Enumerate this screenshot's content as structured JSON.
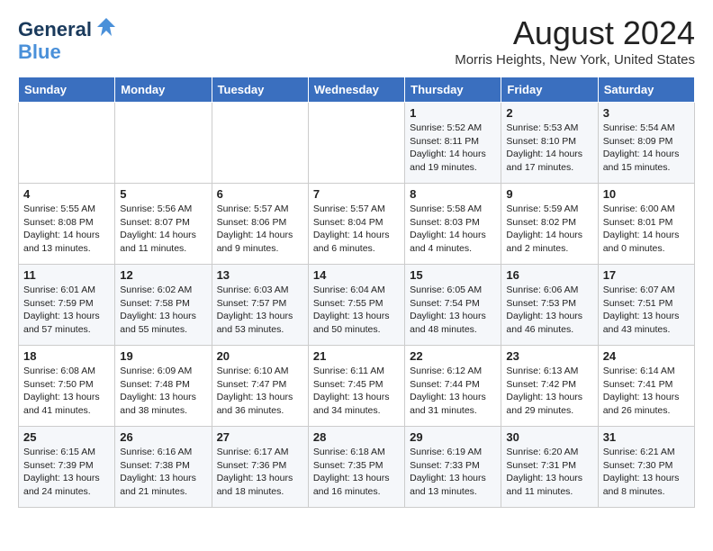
{
  "logo": {
    "general": "General",
    "blue": "Blue",
    "bird_symbol": "🐦"
  },
  "title": "August 2024",
  "location": "Morris Heights, New York, United States",
  "weekdays": [
    "Sunday",
    "Monday",
    "Tuesday",
    "Wednesday",
    "Thursday",
    "Friday",
    "Saturday"
  ],
  "weeks": [
    [
      {
        "day": "",
        "sunrise": "",
        "sunset": "",
        "daylight": ""
      },
      {
        "day": "",
        "sunrise": "",
        "sunset": "",
        "daylight": ""
      },
      {
        "day": "",
        "sunrise": "",
        "sunset": "",
        "daylight": ""
      },
      {
        "day": "",
        "sunrise": "",
        "sunset": "",
        "daylight": ""
      },
      {
        "day": "1",
        "sunrise": "Sunrise: 5:52 AM",
        "sunset": "Sunset: 8:11 PM",
        "daylight": "Daylight: 14 hours and 19 minutes."
      },
      {
        "day": "2",
        "sunrise": "Sunrise: 5:53 AM",
        "sunset": "Sunset: 8:10 PM",
        "daylight": "Daylight: 14 hours and 17 minutes."
      },
      {
        "day": "3",
        "sunrise": "Sunrise: 5:54 AM",
        "sunset": "Sunset: 8:09 PM",
        "daylight": "Daylight: 14 hours and 15 minutes."
      }
    ],
    [
      {
        "day": "4",
        "sunrise": "Sunrise: 5:55 AM",
        "sunset": "Sunset: 8:08 PM",
        "daylight": "Daylight: 14 hours and 13 minutes."
      },
      {
        "day": "5",
        "sunrise": "Sunrise: 5:56 AM",
        "sunset": "Sunset: 8:07 PM",
        "daylight": "Daylight: 14 hours and 11 minutes."
      },
      {
        "day": "6",
        "sunrise": "Sunrise: 5:57 AM",
        "sunset": "Sunset: 8:06 PM",
        "daylight": "Daylight: 14 hours and 9 minutes."
      },
      {
        "day": "7",
        "sunrise": "Sunrise: 5:57 AM",
        "sunset": "Sunset: 8:04 PM",
        "daylight": "Daylight: 14 hours and 6 minutes."
      },
      {
        "day": "8",
        "sunrise": "Sunrise: 5:58 AM",
        "sunset": "Sunset: 8:03 PM",
        "daylight": "Daylight: 14 hours and 4 minutes."
      },
      {
        "day": "9",
        "sunrise": "Sunrise: 5:59 AM",
        "sunset": "Sunset: 8:02 PM",
        "daylight": "Daylight: 14 hours and 2 minutes."
      },
      {
        "day": "10",
        "sunrise": "Sunrise: 6:00 AM",
        "sunset": "Sunset: 8:01 PM",
        "daylight": "Daylight: 14 hours and 0 minutes."
      }
    ],
    [
      {
        "day": "11",
        "sunrise": "Sunrise: 6:01 AM",
        "sunset": "Sunset: 7:59 PM",
        "daylight": "Daylight: 13 hours and 57 minutes."
      },
      {
        "day": "12",
        "sunrise": "Sunrise: 6:02 AM",
        "sunset": "Sunset: 7:58 PM",
        "daylight": "Daylight: 13 hours and 55 minutes."
      },
      {
        "day": "13",
        "sunrise": "Sunrise: 6:03 AM",
        "sunset": "Sunset: 7:57 PM",
        "daylight": "Daylight: 13 hours and 53 minutes."
      },
      {
        "day": "14",
        "sunrise": "Sunrise: 6:04 AM",
        "sunset": "Sunset: 7:55 PM",
        "daylight": "Daylight: 13 hours and 50 minutes."
      },
      {
        "day": "15",
        "sunrise": "Sunrise: 6:05 AM",
        "sunset": "Sunset: 7:54 PM",
        "daylight": "Daylight: 13 hours and 48 minutes."
      },
      {
        "day": "16",
        "sunrise": "Sunrise: 6:06 AM",
        "sunset": "Sunset: 7:53 PM",
        "daylight": "Daylight: 13 hours and 46 minutes."
      },
      {
        "day": "17",
        "sunrise": "Sunrise: 6:07 AM",
        "sunset": "Sunset: 7:51 PM",
        "daylight": "Daylight: 13 hours and 43 minutes."
      }
    ],
    [
      {
        "day": "18",
        "sunrise": "Sunrise: 6:08 AM",
        "sunset": "Sunset: 7:50 PM",
        "daylight": "Daylight: 13 hours and 41 minutes."
      },
      {
        "day": "19",
        "sunrise": "Sunrise: 6:09 AM",
        "sunset": "Sunset: 7:48 PM",
        "daylight": "Daylight: 13 hours and 38 minutes."
      },
      {
        "day": "20",
        "sunrise": "Sunrise: 6:10 AM",
        "sunset": "Sunset: 7:47 PM",
        "daylight": "Daylight: 13 hours and 36 minutes."
      },
      {
        "day": "21",
        "sunrise": "Sunrise: 6:11 AM",
        "sunset": "Sunset: 7:45 PM",
        "daylight": "Daylight: 13 hours and 34 minutes."
      },
      {
        "day": "22",
        "sunrise": "Sunrise: 6:12 AM",
        "sunset": "Sunset: 7:44 PM",
        "daylight": "Daylight: 13 hours and 31 minutes."
      },
      {
        "day": "23",
        "sunrise": "Sunrise: 6:13 AM",
        "sunset": "Sunset: 7:42 PM",
        "daylight": "Daylight: 13 hours and 29 minutes."
      },
      {
        "day": "24",
        "sunrise": "Sunrise: 6:14 AM",
        "sunset": "Sunset: 7:41 PM",
        "daylight": "Daylight: 13 hours and 26 minutes."
      }
    ],
    [
      {
        "day": "25",
        "sunrise": "Sunrise: 6:15 AM",
        "sunset": "Sunset: 7:39 PM",
        "daylight": "Daylight: 13 hours and 24 minutes."
      },
      {
        "day": "26",
        "sunrise": "Sunrise: 6:16 AM",
        "sunset": "Sunset: 7:38 PM",
        "daylight": "Daylight: 13 hours and 21 minutes."
      },
      {
        "day": "27",
        "sunrise": "Sunrise: 6:17 AM",
        "sunset": "Sunset: 7:36 PM",
        "daylight": "Daylight: 13 hours and 18 minutes."
      },
      {
        "day": "28",
        "sunrise": "Sunrise: 6:18 AM",
        "sunset": "Sunset: 7:35 PM",
        "daylight": "Daylight: 13 hours and 16 minutes."
      },
      {
        "day": "29",
        "sunrise": "Sunrise: 6:19 AM",
        "sunset": "Sunset: 7:33 PM",
        "daylight": "Daylight: 13 hours and 13 minutes."
      },
      {
        "day": "30",
        "sunrise": "Sunrise: 6:20 AM",
        "sunset": "Sunset: 7:31 PM",
        "daylight": "Daylight: 13 hours and 11 minutes."
      },
      {
        "day": "31",
        "sunrise": "Sunrise: 6:21 AM",
        "sunset": "Sunset: 7:30 PM",
        "daylight": "Daylight: 13 hours and 8 minutes."
      }
    ]
  ]
}
